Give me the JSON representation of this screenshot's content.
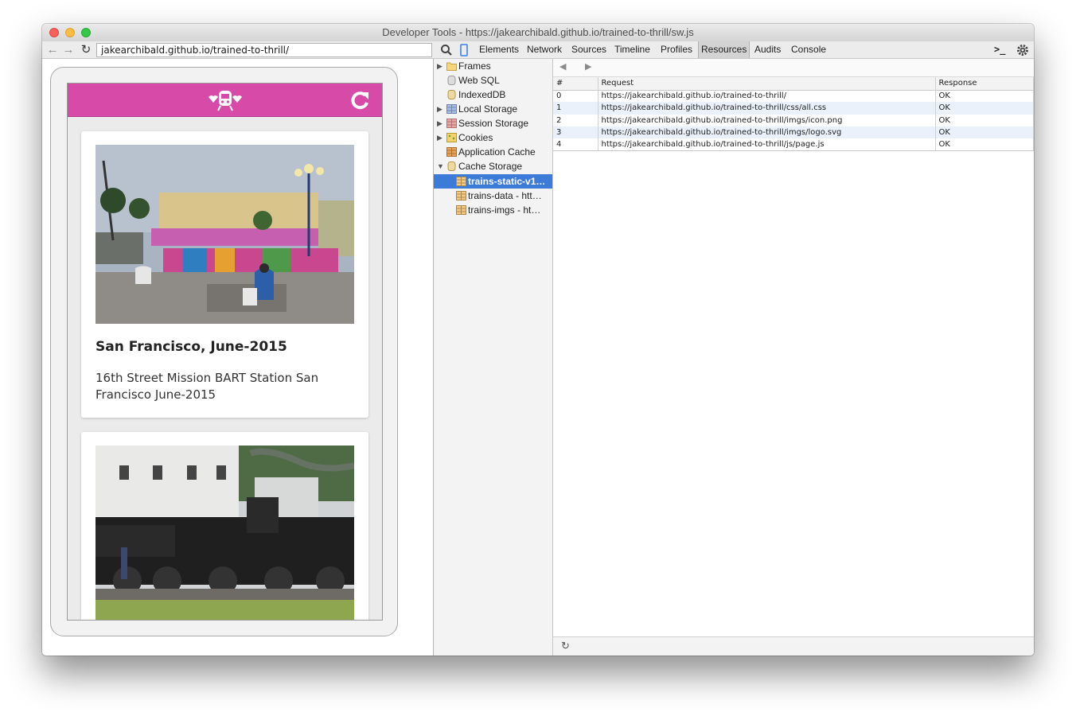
{
  "window": {
    "title": "Developer Tools - https://jakearchibald.github.io/trained-to-thrill/sw.js"
  },
  "browser": {
    "url": "jakearchibald.github.io/trained-to-thrill/"
  },
  "app": {
    "brand_color": "#d84aa8",
    "cards": [
      {
        "title": "San Francisco, June-2015",
        "description": "16th Street Mission BART Station San Francisco June-2015"
      },
      {
        "title": "",
        "description": ""
      }
    ]
  },
  "devtools": {
    "tabs": [
      "Elements",
      "Network",
      "Sources",
      "Timeline",
      "Profiles",
      "Resources",
      "Audits",
      "Console"
    ],
    "active_tab": "Resources",
    "tree": [
      {
        "label": "Frames",
        "icon": "folder-icon",
        "expandable": true
      },
      {
        "label": "Web SQL",
        "icon": "database-icon",
        "expandable": false
      },
      {
        "label": "IndexedDB",
        "icon": "database-icon",
        "expandable": false
      },
      {
        "label": "Local Storage",
        "icon": "grid-icon",
        "expandable": true
      },
      {
        "label": "Session Storage",
        "icon": "grid-icon",
        "expandable": true
      },
      {
        "label": "Cookies",
        "icon": "cookie-icon",
        "expandable": true
      },
      {
        "label": "Application Cache",
        "icon": "grid-icon",
        "expandable": false
      },
      {
        "label": "Cache Storage",
        "icon": "database-icon",
        "expanded": true
      }
    ],
    "cache_items": [
      {
        "label": "trains-static-v1…",
        "selected": true
      },
      {
        "label": "trains-data - htt…",
        "selected": false
      },
      {
        "label": "trains-imgs - ht…",
        "selected": false
      }
    ],
    "table": {
      "columns": [
        "#",
        "Request",
        "Response"
      ],
      "rows": [
        [
          "0",
          "https://jakearchibald.github.io/trained-to-thrill/",
          "OK"
        ],
        [
          "1",
          "https://jakearchibald.github.io/trained-to-thrill/css/all.css",
          "OK"
        ],
        [
          "2",
          "https://jakearchibald.github.io/trained-to-thrill/imgs/icon.png",
          "OK"
        ],
        [
          "3",
          "https://jakearchibald.github.io/trained-to-thrill/imgs/logo.svg",
          "OK"
        ],
        [
          "4",
          "https://jakearchibald.github.io/trained-to-thrill/js/page.js",
          "OK"
        ]
      ]
    }
  }
}
